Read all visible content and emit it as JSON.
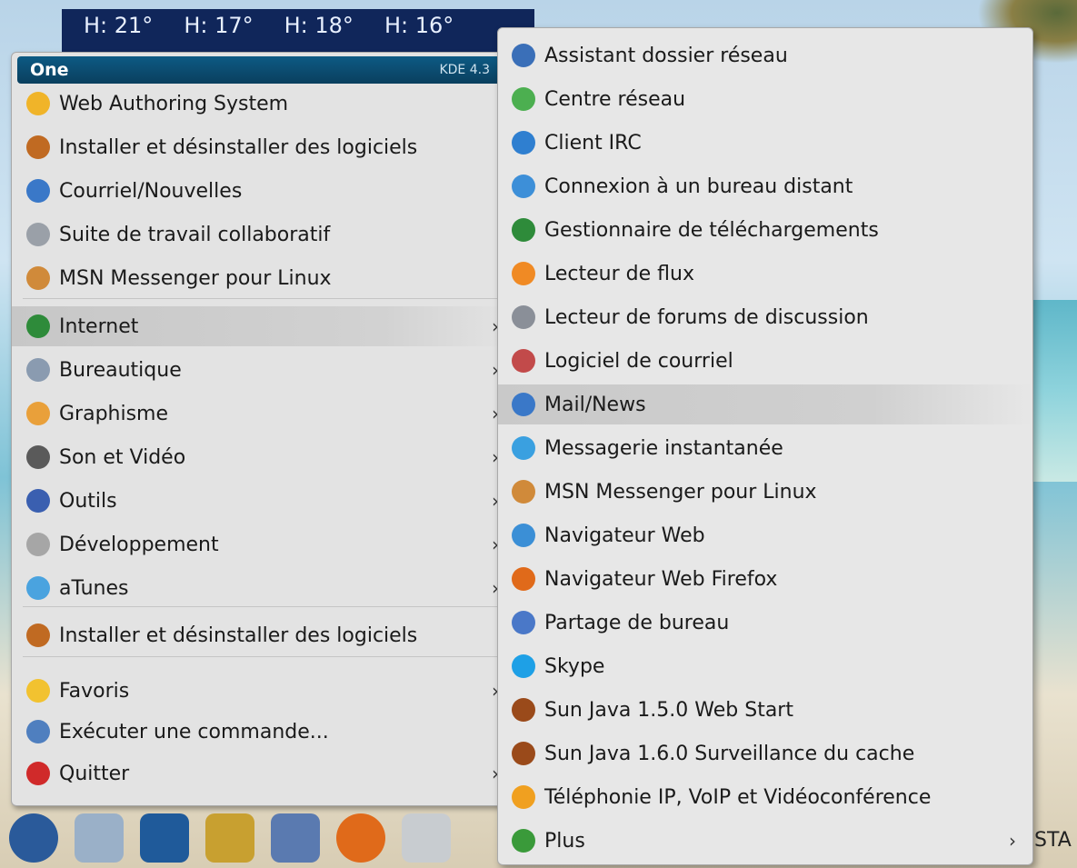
{
  "weather": [
    "H: 21°",
    "H: 17°",
    "H: 18°",
    "H: 16°"
  ],
  "menu": {
    "title": "One",
    "version": "KDE 4.3",
    "items": [
      {
        "label": "Web Authoring System",
        "icon": "web-authoring-icon",
        "color": "#f0b429"
      },
      {
        "label": "Installer et désinstaller des logiciels",
        "icon": "install-software-icon",
        "color": "#c06a22"
      },
      {
        "label": "Courriel/Nouvelles",
        "icon": "mail-news-icon",
        "color": "#3a78c8"
      },
      {
        "label": "Suite de travail collaboratif",
        "icon": "collaboration-suite-icon",
        "color": "#9aa0a8"
      },
      {
        "label": "MSN Messenger pour Linux",
        "icon": "msn-messenger-icon",
        "color": "#d08a3a"
      },
      {
        "label": "Internet",
        "icon": "internet-globe-icon",
        "color": "#2e8b3a",
        "submenu": true
      },
      {
        "label": "Bureautique",
        "icon": "office-icon",
        "color": "#8a9bb0",
        "submenu": true
      },
      {
        "label": "Graphisme",
        "icon": "graphics-palette-icon",
        "color": "#e9a03a",
        "submenu": true
      },
      {
        "label": "Son et Vidéo",
        "icon": "sound-video-icon",
        "color": "#5a5a5a",
        "submenu": true
      },
      {
        "label": "Outils",
        "icon": "tools-icon",
        "color": "#3a5fb0",
        "submenu": true
      },
      {
        "label": "Développement",
        "icon": "development-icon",
        "color": "#a6a6a6",
        "submenu": true
      },
      {
        "label": "aTunes",
        "icon": "folder-icon",
        "color": "#4aa3df",
        "submenu": true
      },
      {
        "label": "Installer et désinstaller des logiciels",
        "icon": "install-software-icon",
        "color": "#c06a22"
      },
      {
        "label": "Favoris",
        "icon": "star-icon",
        "color": "#f2c230",
        "submenu": true
      },
      {
        "label": "Exécuter une commande...",
        "icon": "run-command-icon",
        "color": "#4f7fbf"
      },
      {
        "label": "Quitter",
        "icon": "power-icon",
        "color": "#d02a2a",
        "submenu": true
      }
    ]
  },
  "submenu": {
    "items": [
      {
        "label": "Assistant dossier réseau",
        "icon": "network-folder-icon",
        "color": "#3a6fb8"
      },
      {
        "label": "Centre réseau",
        "icon": "network-center-icon",
        "color": "#4caf50"
      },
      {
        "label": "Client IRC",
        "icon": "irc-client-icon",
        "color": "#2f7fd0"
      },
      {
        "label": "Connexion à un bureau distant",
        "icon": "remote-desktop-icon",
        "color": "#3d8fd8"
      },
      {
        "label": "Gestionnaire de téléchargements",
        "icon": "download-manager-icon",
        "color": "#2e8b3a"
      },
      {
        "label": "Lecteur de flux",
        "icon": "feed-reader-icon",
        "color": "#f08a24"
      },
      {
        "label": "Lecteur de forums de discussion",
        "icon": "newsgroup-reader-icon",
        "color": "#8a8f98"
      },
      {
        "label": "Logiciel de courriel",
        "icon": "mail-client-icon",
        "color": "#c24a4a"
      },
      {
        "label": "Mail/News",
        "icon": "mail-news-icon",
        "color": "#3a78c8"
      },
      {
        "label": "Messagerie instantanée",
        "icon": "instant-messaging-icon",
        "color": "#3aa0e0"
      },
      {
        "label": "MSN Messenger pour Linux",
        "icon": "msn-messenger-icon",
        "color": "#d08a3a"
      },
      {
        "label": "Navigateur Web",
        "icon": "web-browser-icon",
        "color": "#3b8fd6"
      },
      {
        "label": "Navigateur Web Firefox",
        "icon": "firefox-icon",
        "color": "#e06a1a"
      },
      {
        "label": "Partage de bureau",
        "icon": "desktop-sharing-icon",
        "color": "#4a78c8"
      },
      {
        "label": "Skype",
        "icon": "skype-icon",
        "color": "#1ea0e6"
      },
      {
        "label": "Sun Java 1.5.0 Web Start",
        "icon": "java-icon",
        "color": "#9a4a1a"
      },
      {
        "label": "Sun Java 1.6.0 Surveillance du cache",
        "icon": "java-icon",
        "color": "#9a4a1a"
      },
      {
        "label": "Téléphonie IP, VoIP et Vidéoconférence",
        "icon": "voip-icon",
        "color": "#f0a020"
      },
      {
        "label": "Plus",
        "icon": "more-icon",
        "color": "#3a9a3a",
        "submenu": true
      }
    ]
  },
  "taskbar": {
    "items": [
      {
        "icon": "kde-start-icon",
        "color": "#2a5a9a"
      },
      {
        "icon": "usb-device-icon",
        "color": "#9ab0c8"
      },
      {
        "icon": "desktop-pager-icon",
        "color": "#1f5a9a"
      },
      {
        "icon": "system-tools-icon",
        "color": "#c8a030"
      },
      {
        "icon": "remote-help-icon",
        "color": "#5a7ab0"
      },
      {
        "icon": "firefox-icon",
        "color": "#e06a1a"
      },
      {
        "icon": "mail-icon",
        "color": "#c8ccd0"
      }
    ],
    "tray_text": "STA"
  },
  "colors": {
    "menu_header": "#0a3f5e",
    "menu_bg": "#e3e3e3",
    "highlight": "#c7c7c7",
    "weather_bg": "#10265a"
  }
}
